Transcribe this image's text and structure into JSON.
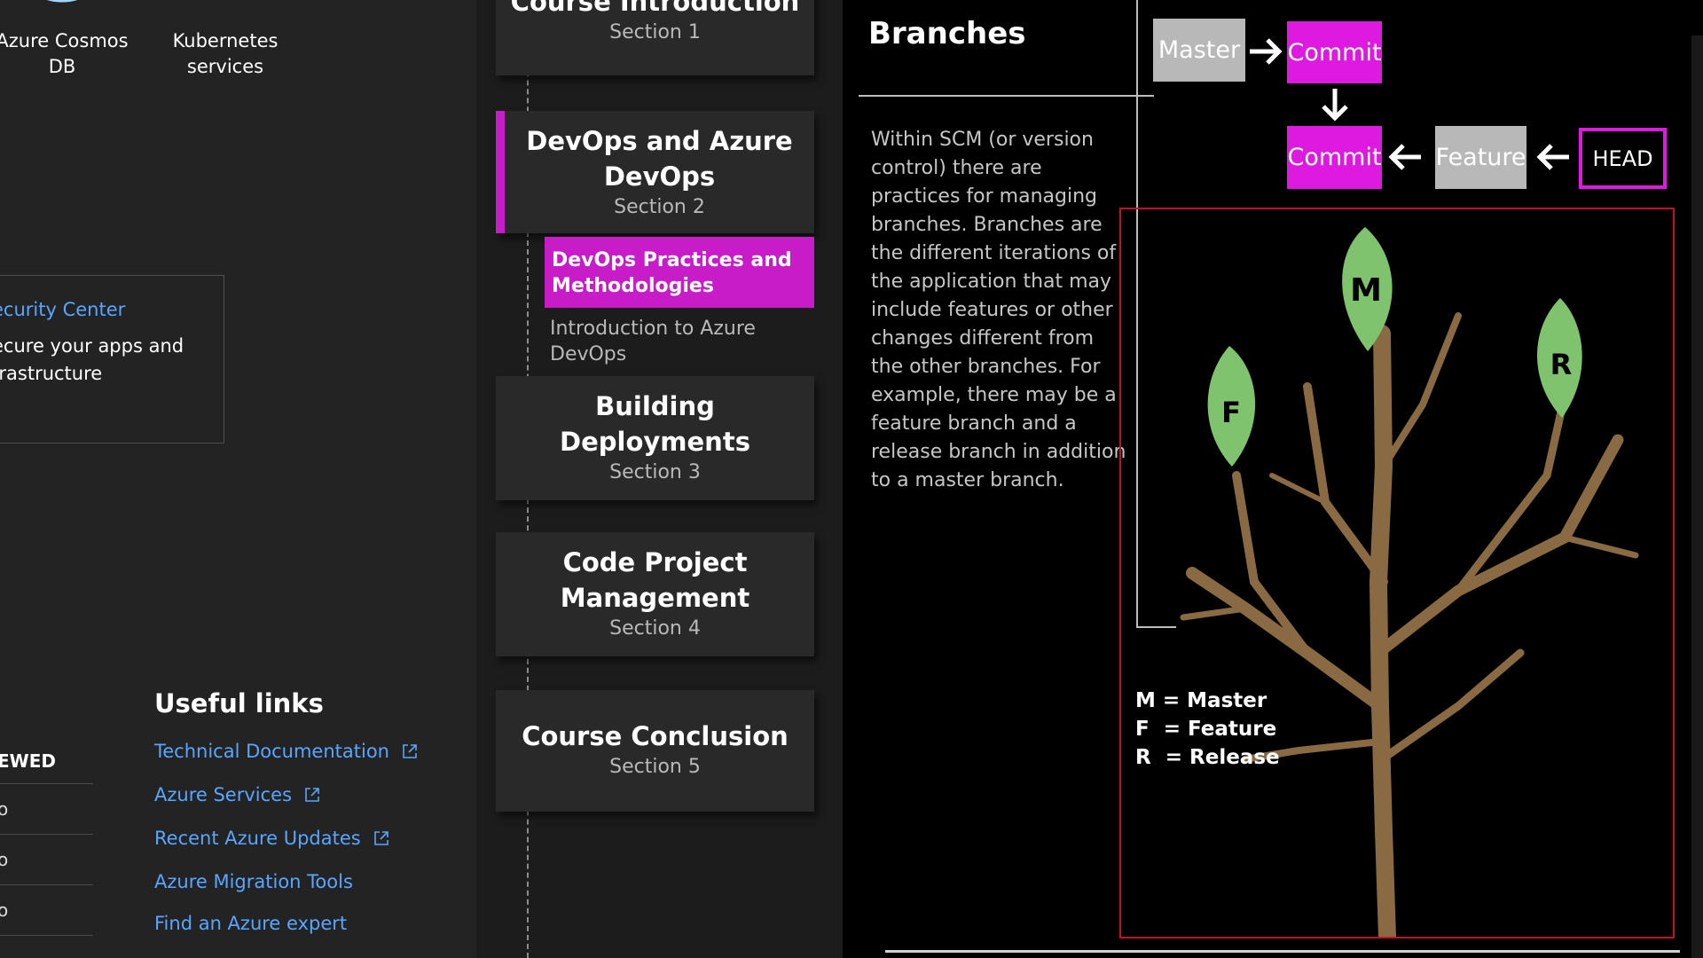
{
  "azure": {
    "tiles": [
      {
        "label": "Azure Cosmos\nDB",
        "icon": "cosmos-db-icon"
      },
      {
        "label": "Kubernetes\nservices",
        "icon": "kubernetes-icon"
      }
    ],
    "security_card": {
      "link": "ecurity Center",
      "description": "ecure your apps and\nfrastructure"
    },
    "recent": {
      "heading": "EWED",
      "rows": [
        "o",
        "o",
        "o"
      ]
    },
    "useful_links": {
      "title": "Useful links",
      "items": [
        {
          "label": "Technical Documentation",
          "external": true
        },
        {
          "label": "Azure Services",
          "external": true
        },
        {
          "label": "Recent Azure Updates",
          "external": true
        },
        {
          "label": "Azure Migration Tools",
          "external": false
        },
        {
          "label": "Find an Azure expert",
          "external": false
        }
      ]
    }
  },
  "course": {
    "sections": [
      {
        "title": "Course Introduction",
        "subtitle": "Section 1"
      },
      {
        "title": "DevOps and Azure DevOps",
        "subtitle": "Section 2"
      },
      {
        "title": "Building Deployments",
        "subtitle": "Section 3"
      },
      {
        "title": "Code Project Management",
        "subtitle": "Section 4"
      },
      {
        "title": "Course Conclusion",
        "subtitle": "Section 5"
      }
    ],
    "lessons": [
      {
        "label": "DevOps Practices and Methodologies",
        "active": true
      },
      {
        "label": "Introduction to Azure DevOps",
        "active": false
      }
    ]
  },
  "slide": {
    "title": "Branches",
    "body": "Within SCM (or version control) there are practices for managing branches. Branches are the different iterations of the application that may include features or other changes different from the other branches. For example, there may be a feature branch and a release branch in addition to a master branch.",
    "diagram": {
      "master": "Master",
      "commit_top": "Commit",
      "commit_bottom": "Commit",
      "feature": "Feature",
      "head": "HEAD"
    },
    "leaves": {
      "m": "M",
      "f": "F",
      "r": "R"
    },
    "legend": "M = Master\nF  = Feature\nR  = Release"
  },
  "colors": {
    "accent": "#df1ae0",
    "link": "#58a6ff",
    "leaf": "#7fc36e",
    "trunk": "#8a6a43",
    "frame": "#c0102a"
  }
}
